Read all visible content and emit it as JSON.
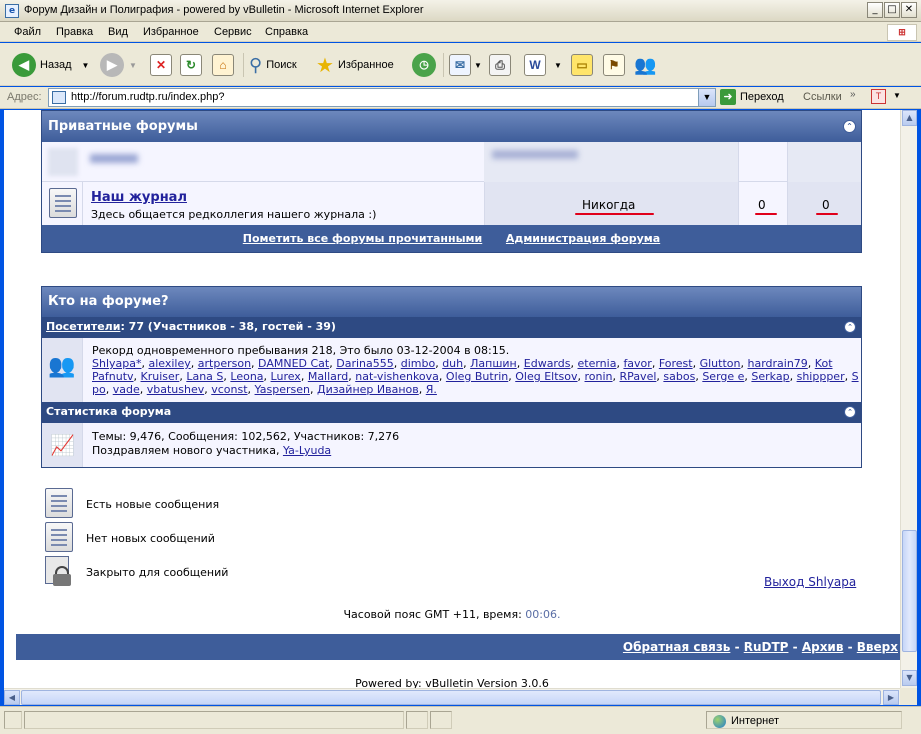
{
  "window": {
    "title": "Форум Дизайн и Полиграфия - powered by vBulletin - Microsoft Internet Explorer",
    "controls": {
      "minimize": "_",
      "maximize": "□",
      "close": "✕"
    }
  },
  "menu": [
    "Файл",
    "Правка",
    "Вид",
    "Избранное",
    "Сервис",
    "Справка"
  ],
  "toolbar": {
    "back": "Назад",
    "search": "Поиск",
    "favorites": "Избранное"
  },
  "address": {
    "label": "Адрес:",
    "url": "http://forum.rudtp.ru/index.php?",
    "go": "Переход",
    "links": "Ссылки"
  },
  "private_forums": {
    "category_title": "Приватные форумы",
    "forum": {
      "name": "Наш журнал",
      "description": "Здесь общается редколлегия нашего журнала :)",
      "last_post": "Никогда",
      "threads": "0",
      "posts": "0"
    },
    "footer_links": [
      "Пометить все форумы прочитанными",
      "Администрация форума"
    ]
  },
  "whos_online": {
    "title": "Кто на форуме?",
    "visitors_label": "Посетители",
    "visitors_summary": ": 77 (Участников - 38, гостей - 39)",
    "record": "Рекорд одновременного пребывания 218, Это было 03-12-2004 в 08:15.",
    "users": [
      "Shlyapa*",
      "alexiley",
      "artperson",
      "DAMNED Cat",
      "Darina555",
      "dimbo",
      "duh",
      "Лапшин",
      "Edwards",
      "eternia",
      "favor",
      "Forest",
      "Glutton",
      "hardrain79",
      "Kot Pafnutv",
      "Kruiser",
      "Lana S",
      "Leona",
      "Lurex",
      "Mallard",
      "nat-vishenkova",
      "Oleg Butrin",
      "Oleg Eltsov",
      "ronin",
      "RPavel",
      "sabos",
      "Serge e",
      "Serkap",
      "shippper",
      "S po",
      "vade",
      "vbatushev",
      "vconst",
      "Yaspersen",
      "Дизайнер Иванов",
      "Я."
    ],
    "stats_title": "Статистика форума",
    "stats_line": "Темы: 9,476, Сообщения: 102,562, Участников: 7,276",
    "welcome_prefix": "Поздравляем нового участника, ",
    "newest_member": "Ya-Lyuda"
  },
  "legend": [
    "Есть новые сообщения",
    "Нет новых сообщений",
    "Закрыто для сообщений"
  ],
  "logout": "Выход Shlyapa",
  "timezone_prefix": "Часовой пояс GMT +11, время: ",
  "time": "00:06.",
  "footer_links": [
    "Обратная связь",
    "RuDTP",
    "Архив",
    "Вверх"
  ],
  "powered_by": "Powered by: vBulletin Version 3.0.6",
  "status": {
    "zone": "Интернет"
  }
}
